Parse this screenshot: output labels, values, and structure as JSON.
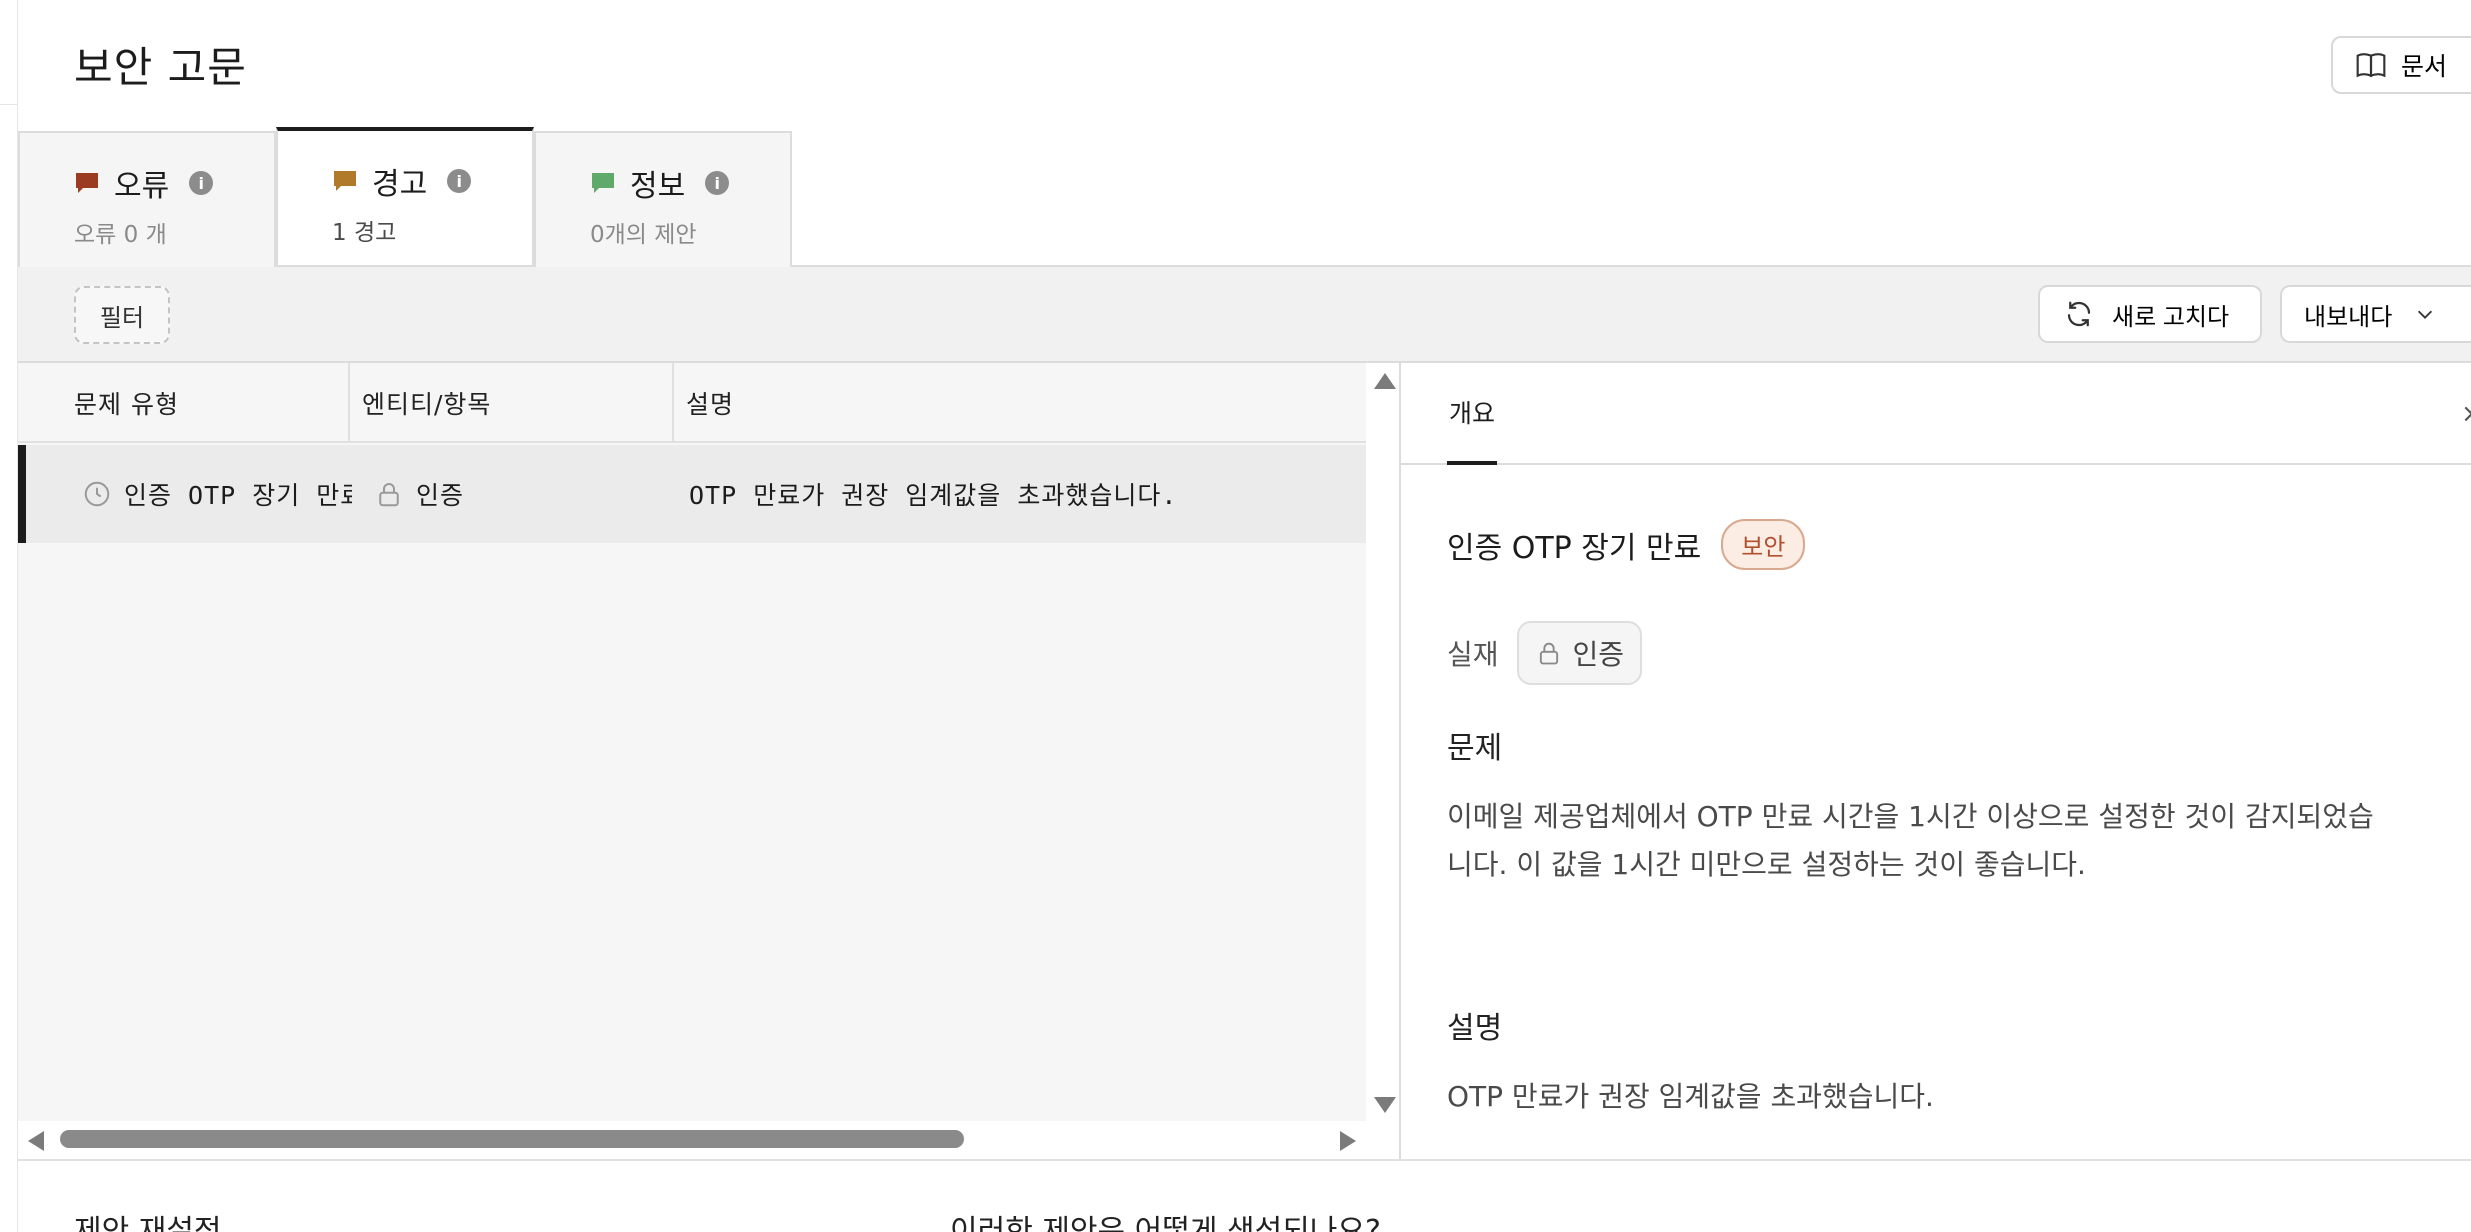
{
  "header": {
    "title": "보안 고문",
    "docs_label": "문서"
  },
  "tabs": [
    {
      "label": "오류",
      "sub": "오류 0 개",
      "flag_color": "#9b3b22"
    },
    {
      "label": "경고",
      "sub": "1 경고",
      "flag_color": "#b07a2a"
    },
    {
      "label": "정보",
      "sub": "0개의 제안",
      "flag_color": "#5fa96a"
    }
  ],
  "toolbar": {
    "filter_label": "필터",
    "refresh_label": "새로 고치다",
    "export_label": "내보내다"
  },
  "table": {
    "columns": [
      "문제 유형",
      "엔티티/항목",
      "설명"
    ],
    "rows": [
      {
        "type": "인증 OTP 장기 만료",
        "entity": "인증",
        "description": "OTP 만료가 권장 임계값을 초과했습니다."
      }
    ]
  },
  "detail": {
    "tab_label": "개요",
    "close_glyph": "×",
    "title": "인증 OTP 장기 만료",
    "badge": "보안",
    "entity_label": "실재",
    "entity_value": "인증",
    "problem_heading": "문제",
    "problem_text_1": "이메일 제공업체에서 OTP 만료 시간을 1시간 이상으로 설정한 것이 감지되었습",
    "problem_text_2": "니다. 이 값을 1시간 미만으로 설정하는 것이 좋습니다.",
    "description_heading": "설명",
    "description_text": "OTP 만료가 권장 임계값을 초과했습니다."
  },
  "bottom": {
    "left_heading": "제안 재설정",
    "right_heading": "이러한 제안은 어떻게 생성되나요?"
  },
  "colors": {
    "badge_text": "#b0502e",
    "badge_bg": "#fbece4",
    "active_tab_border": "#1c1c1c"
  }
}
